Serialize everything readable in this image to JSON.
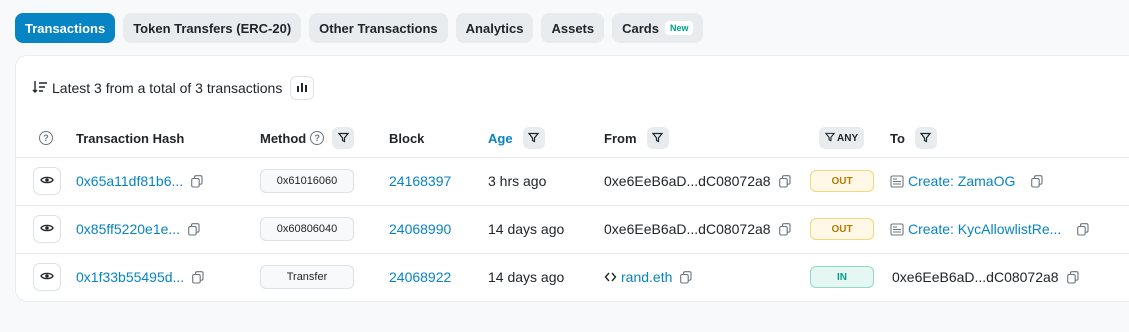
{
  "tabs": [
    {
      "label": "Transactions",
      "active": true
    },
    {
      "label": "Token Transfers (ERC-20)",
      "active": false
    },
    {
      "label": "Other Transactions",
      "active": false
    },
    {
      "label": "Analytics",
      "active": false
    },
    {
      "label": "Assets",
      "active": false
    },
    {
      "label": "Cards",
      "active": false,
      "badge": "New"
    }
  ],
  "summary": {
    "text": "Latest 3 from a total of 3 transactions"
  },
  "columns": {
    "hash": "Transaction Hash",
    "method": "Method",
    "block": "Block",
    "age": "Age",
    "from": "From",
    "direction_filter": "ANY",
    "to": "To"
  },
  "rows": [
    {
      "hash": "0x65a11df81b6...",
      "method": "0x61016060",
      "block": "24168397",
      "age": "3 hrs ago",
      "from": "0xe6EeB6aD...dC08072a8",
      "direction": "OUT",
      "to": "Create: ZamaOG"
    },
    {
      "hash": "0x85ff5220e1e...",
      "method": "0x60806040",
      "block": "24068990",
      "age": "14 days ago",
      "from": "0xe6EeB6aD...dC08072a8",
      "direction": "OUT",
      "to": "Create: KycAllowlistRe..."
    },
    {
      "hash": "0x1f33b55495d...",
      "method": "Transfer",
      "block": "24068922",
      "age": "14 days ago",
      "from": "rand.eth",
      "direction": "IN",
      "to": "0xe6EeB6aD...dC08072a8"
    }
  ],
  "colors": {
    "accent": "#0784c3",
    "out": "#b47d00",
    "in": "#00a186"
  },
  "icons": [
    "sort-icon",
    "chart-icon",
    "help-icon",
    "filter-icon",
    "eye-icon",
    "copy-icon",
    "contract-icon",
    "ens-icon"
  ]
}
